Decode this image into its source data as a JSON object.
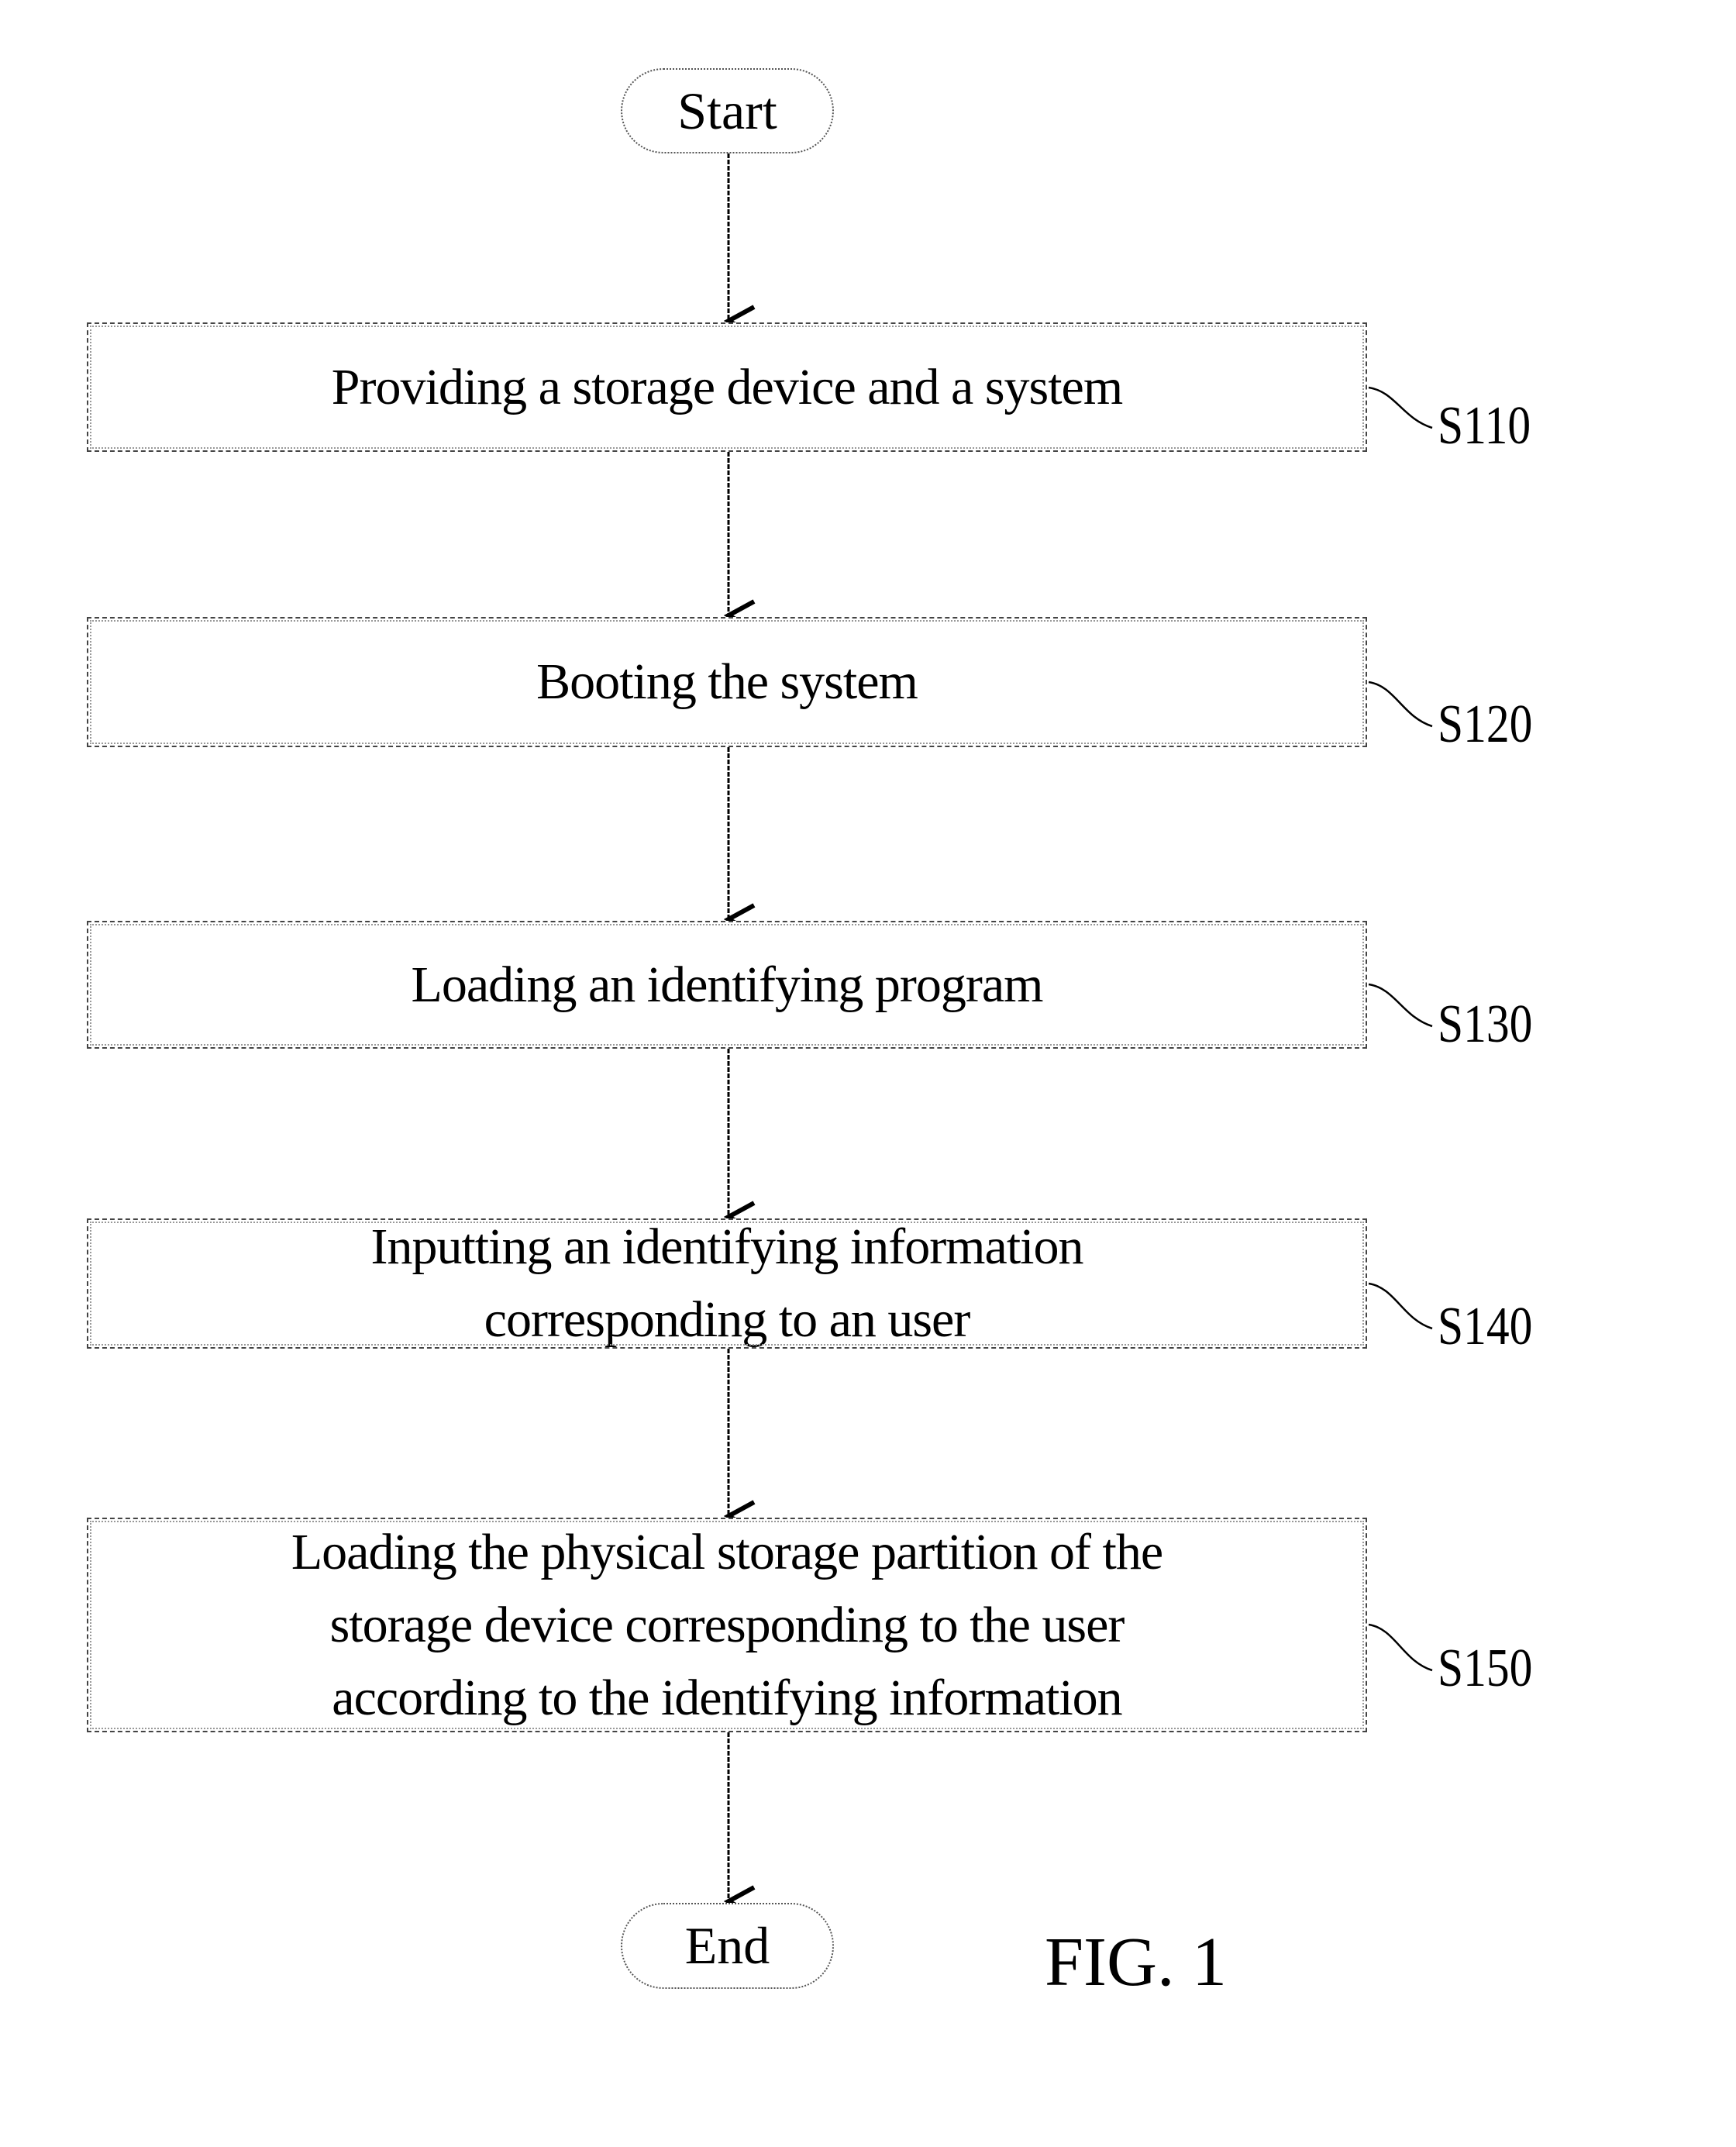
{
  "figure_label": "FIG. 1",
  "terminals": {
    "start": "Start",
    "end": "End"
  },
  "steps": [
    {
      "id": "S110",
      "text": "Providing a storage device and a system"
    },
    {
      "id": "S120",
      "text": "Booting the system"
    },
    {
      "id": "S130",
      "text": "Loading an identifying program"
    },
    {
      "id": "S140",
      "text": "Inputting an identifying information corresponding to an user"
    },
    {
      "id": "S150",
      "text": "Loading the physical storage partition of the storage device corresponding to the user according to the identifying information"
    }
  ],
  "colors": {
    "line": "#000000",
    "background": "#ffffff"
  }
}
